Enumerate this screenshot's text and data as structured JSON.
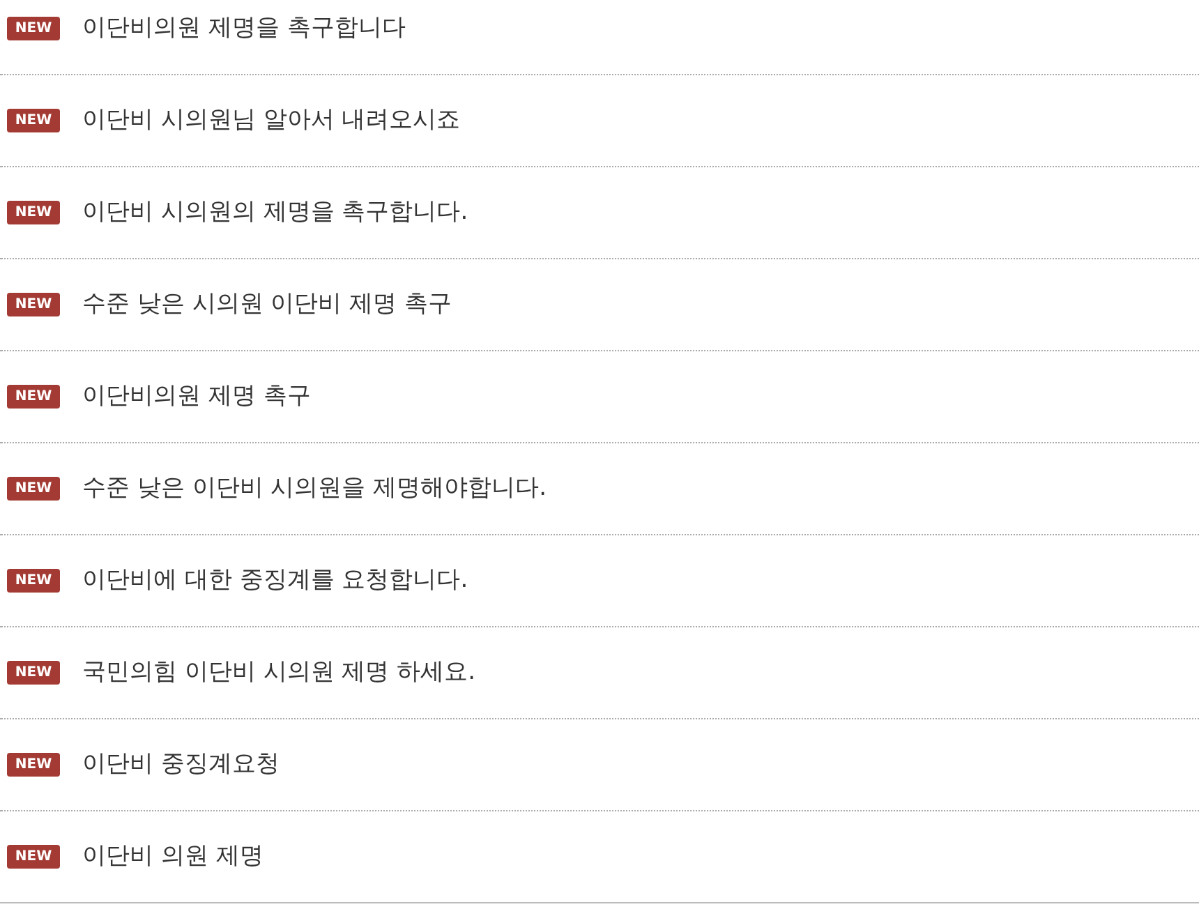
{
  "posts": [
    {
      "badge": "NEW",
      "title": "이단비의원 제명을 촉구합니다"
    },
    {
      "badge": "NEW",
      "title": "이단비 시의원님 알아서 내려오시죠"
    },
    {
      "badge": "NEW",
      "title": "이단비 시의원의 제명을 촉구합니다."
    },
    {
      "badge": "NEW",
      "title": "수준 낮은 시의원 이단비 제명 촉구"
    },
    {
      "badge": "NEW",
      "title": "이단비의원 제명 촉구"
    },
    {
      "badge": "NEW",
      "title": "수준 낮은 이단비 시의원을 제명해야합니다."
    },
    {
      "badge": "NEW",
      "title": "이단비에 대한 중징계를 요청합니다."
    },
    {
      "badge": "NEW",
      "title": "국민의힘 이단비 시의원 제명 하세요."
    },
    {
      "badge": "NEW",
      "title": "이단비 중징계요청"
    },
    {
      "badge": "NEW",
      "title": "이단비 의원 제명"
    }
  ]
}
